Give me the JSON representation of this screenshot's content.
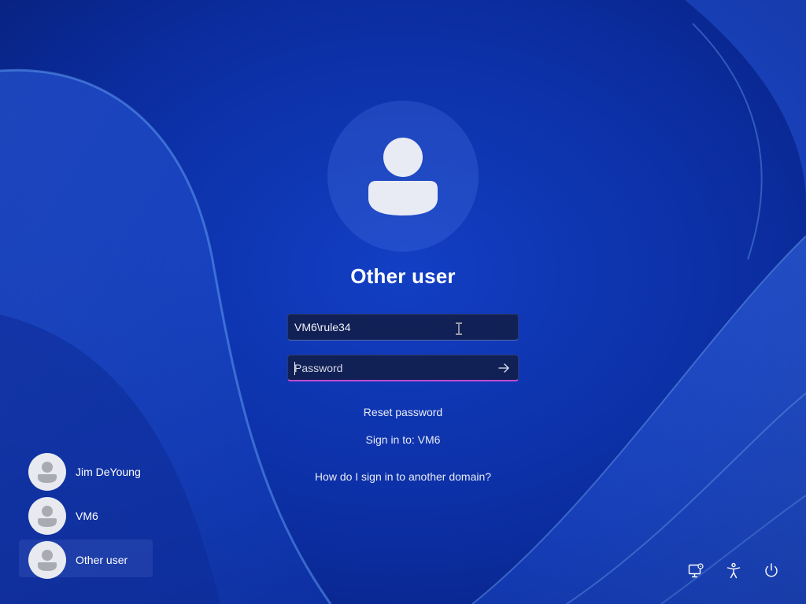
{
  "login": {
    "title": "Other user",
    "username_value": "VM6\\rule34",
    "password_placeholder": "Password",
    "reset_password": "Reset password",
    "sign_in_to": "Sign in to: VM6",
    "domain_help": "How do I sign in to another domain?"
  },
  "user_list": [
    {
      "name": "Jim DeYoung",
      "selected": false
    },
    {
      "name": "VM6",
      "selected": false
    },
    {
      "name": "Other user",
      "selected": true
    }
  ],
  "tray": {
    "icons": [
      "network-icon",
      "accessibility-icon",
      "power-icon"
    ]
  },
  "colors": {
    "background": "#0a2f9e",
    "password_underline": "#c04bd0"
  }
}
